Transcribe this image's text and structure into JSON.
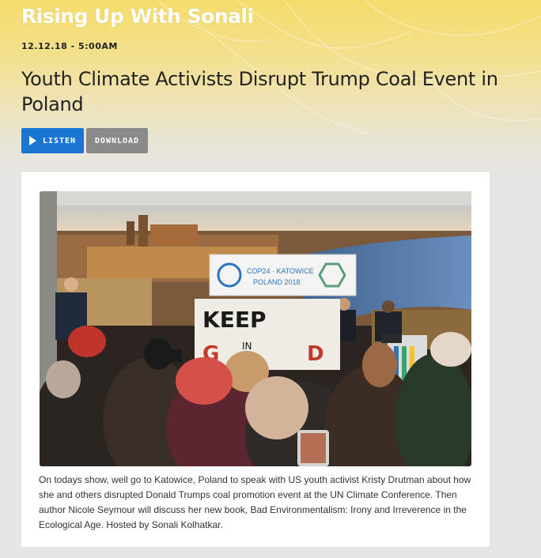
{
  "show": {
    "title": "Rising Up With Sonali"
  },
  "episode": {
    "date": "12.12.18 - 5:00AM",
    "headline": "Youth Climate Activists Disrupt Trump Coal Event in Poland",
    "description": "On todays show, well go to Katowice, Poland to speak with US youth activist Kristy Drutman about how she and others disrupted Donald Trumps coal promotion event at the UN Climate Conference. Then author Nicole Seymour will discuss her new book, Bad Environmentalism: Irony and Irreverence in the Ecological Age. Hosted by Sonali Kolhatkar."
  },
  "actions": {
    "listen_label": "LISTEN",
    "download_label": "DOWNLOAD"
  },
  "photo": {
    "sign_line1": "COP24 · KATOWICE",
    "sign_line2": "POLAND 2018",
    "banner_top": "KEEP",
    "banner_bottom": "IN",
    "banner_left": "G",
    "banner_right": "D"
  },
  "colors": {
    "listen": "#1a76d2",
    "download": "#8a8a8a",
    "hero": "#f5dc6a"
  }
}
